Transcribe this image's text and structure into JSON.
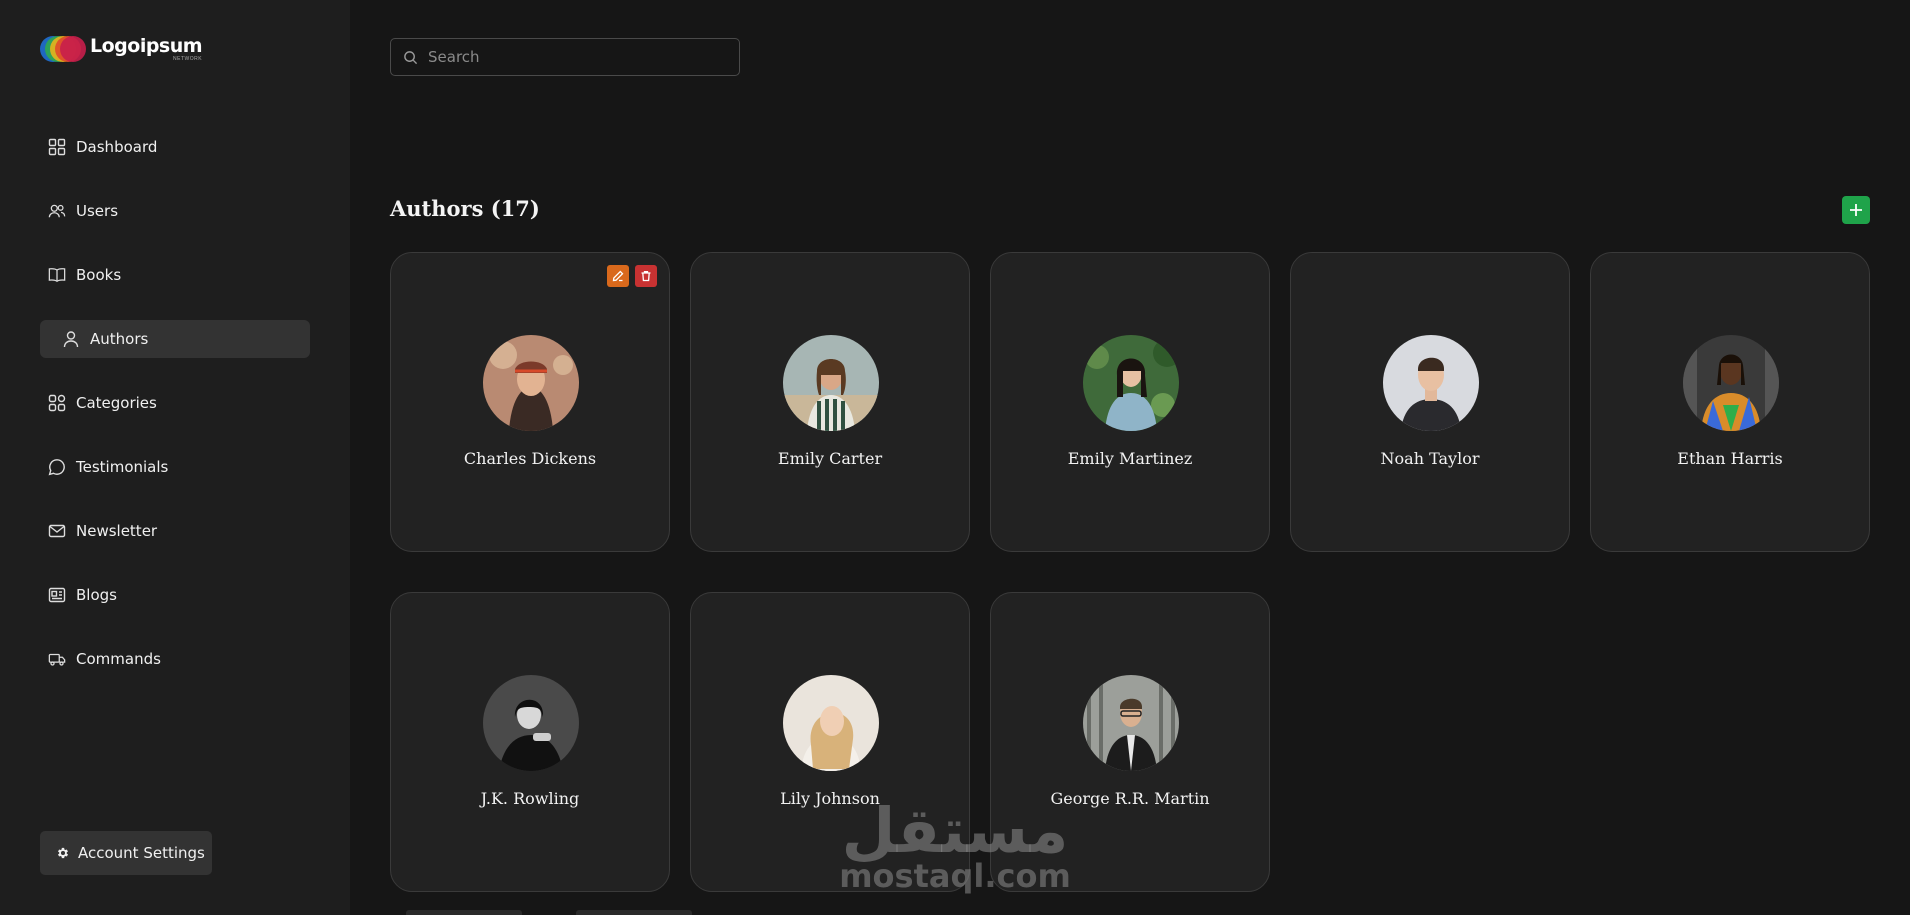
{
  "brand": {
    "name": "Logoipsum",
    "subtitle": "NETWORK",
    "colors": [
      "#1f6fd1",
      "#2fa84f",
      "#e8b21c",
      "#e04a2a",
      "#c81e4b"
    ]
  },
  "sidebar": {
    "items": [
      {
        "label": "Dashboard",
        "icon": "grid-icon",
        "active": false
      },
      {
        "label": "Users",
        "icon": "users-icon",
        "active": false
      },
      {
        "label": "Books",
        "icon": "book-icon",
        "active": false
      },
      {
        "label": "Authors",
        "icon": "user-icon",
        "active": true
      },
      {
        "label": "Categories",
        "icon": "categories-icon",
        "active": false
      },
      {
        "label": "Testimonials",
        "icon": "chat-icon",
        "active": false
      },
      {
        "label": "Newsletter",
        "icon": "mail-icon",
        "active": false
      },
      {
        "label": "Blogs",
        "icon": "newspaper-icon",
        "active": false
      },
      {
        "label": "Commands",
        "icon": "truck-icon",
        "active": false
      }
    ],
    "account_label": "Account Settings"
  },
  "search": {
    "placeholder": "Search",
    "value": ""
  },
  "main": {
    "title": "Authors (17)",
    "authors": [
      {
        "name": "Charles Dickens",
        "avatar_bg": "#b98a72",
        "avatar_fg": "#7b3a2a"
      },
      {
        "name": "Emily Carter",
        "avatar_bg": "#a7b6b4",
        "avatar_fg": "#3e4a44"
      },
      {
        "name": "Emily Martinez",
        "avatar_bg": "#3f6a3a",
        "avatar_fg": "#8fb4c8"
      },
      {
        "name": "Noah Taylor",
        "avatar_bg": "#d8dadf",
        "avatar_fg": "#2a2a2e"
      },
      {
        "name": "Ethan Harris",
        "avatar_bg": "#3a3a3a",
        "avatar_fg": "#d98c2a"
      },
      {
        "name": "J.K. Rowling",
        "avatar_bg": "#4a4a4a",
        "avatar_fg": "#111111"
      },
      {
        "name": "Lily Johnson",
        "avatar_bg": "#eae4dc",
        "avatar_fg": "#d8b27a"
      },
      {
        "name": "George R.R. Martin",
        "avatar_bg": "#9c9f9a",
        "avatar_fg": "#1c1c1c"
      }
    ]
  },
  "colors": {
    "accent_green": "#1fa34a",
    "edit_orange": "#d9691c",
    "delete_red": "#c83232",
    "sidebar_bg": "#1e1e1e",
    "main_bg": "#161616"
  },
  "watermark": {
    "arabic": "مستقل",
    "latin": "mostaql.com"
  }
}
